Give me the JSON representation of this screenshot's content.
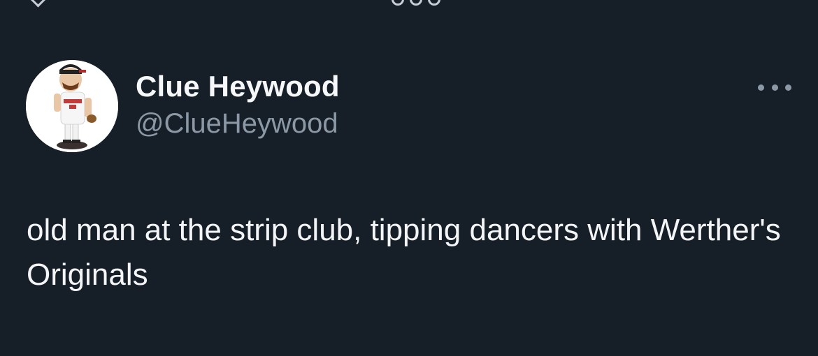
{
  "tweet": {
    "author": {
      "display_name": "Clue Heywood",
      "handle": "@ClueHeywood",
      "avatar_icon": "bobblehead-figure-avatar"
    },
    "text": "old man at the strip club, tipping dancers with Werther's Originals",
    "more_icon": "more-options-icon"
  },
  "colors": {
    "background": "#161e28",
    "primary_text": "#f5f7f9",
    "secondary_text": "#8b98a5"
  }
}
